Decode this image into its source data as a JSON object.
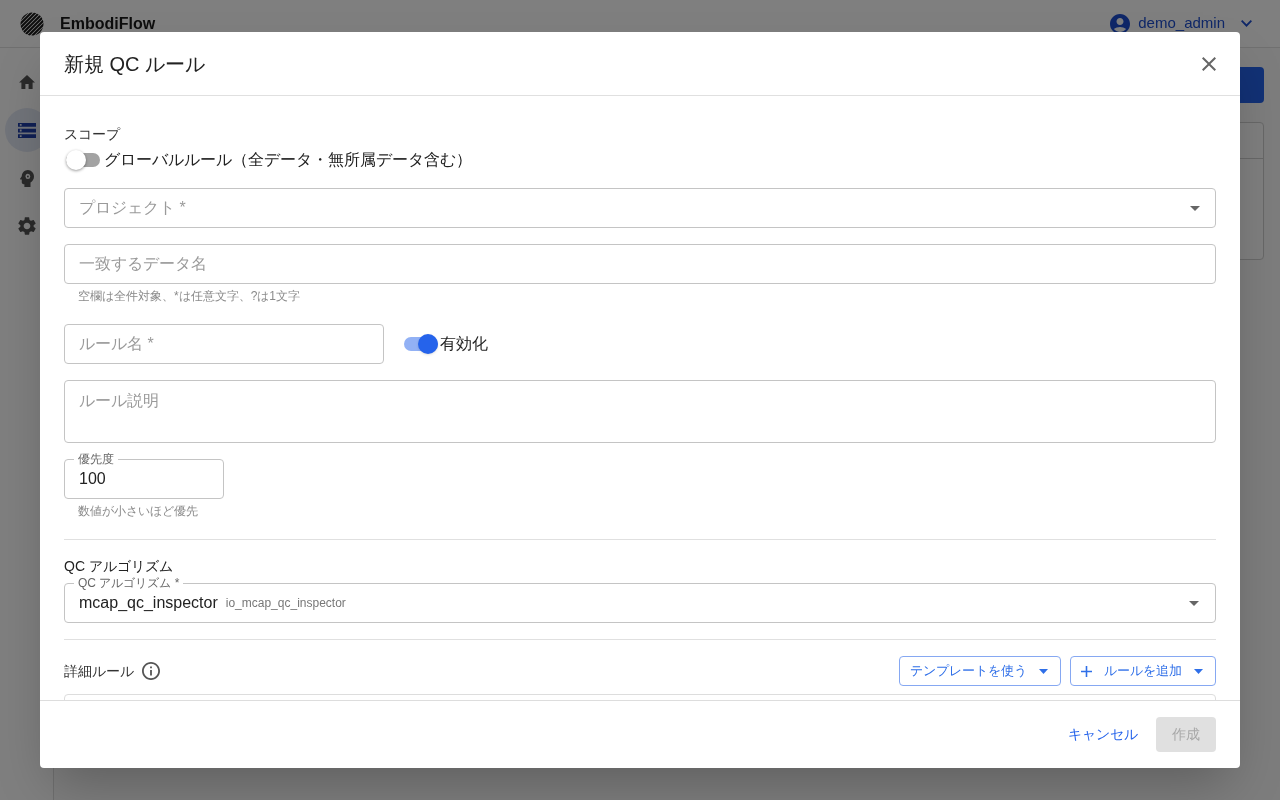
{
  "app_header": {
    "title": "EmbodiFlow",
    "user": "demo_admin"
  },
  "sidebar": {
    "items": [
      {
        "kind": "home",
        "selected": false
      },
      {
        "kind": "list",
        "selected": true
      },
      {
        "kind": "brain",
        "selected": false
      },
      {
        "kind": "settings",
        "selected": false
      }
    ]
  },
  "dialog": {
    "title": "新規 QC ルール",
    "scope": {
      "heading": "スコープ",
      "global_toggle": {
        "label": "グローバルルール（全データ・無所属データ含む）",
        "on": false
      }
    },
    "project_field": {
      "placeholder": "プロジェクト *"
    },
    "data_name_field": {
      "placeholder": "一致するデータ名",
      "helper": "空欄は全件対象、*は任意文字、?は1文字"
    },
    "rule_name_field": {
      "placeholder": "ルール名 *"
    },
    "enabled_toggle": {
      "label": "有効化",
      "on": true
    },
    "description_field": {
      "placeholder": "ルール説明"
    },
    "priority_field": {
      "label": "優先度",
      "value": "100",
      "helper": "数値が小さいほど優先"
    },
    "algorithm": {
      "heading": "QC アルゴリズム",
      "field": {
        "label": "QC アルゴリズム *",
        "value": "mcap_qc_inspector",
        "secondary": "io_mcap_qc_inspector"
      }
    },
    "detail_rules": {
      "heading": "詳細ルール",
      "buttons": [
        {
          "label": "テンプレートを使う",
          "plus": false
        },
        {
          "label": "ルールを追加",
          "plus": true
        }
      ]
    },
    "footer": {
      "buttons": [
        {
          "label": "キャンセル",
          "kind": "text",
          "disabled": false
        },
        {
          "label": "作成",
          "kind": "contained",
          "disabled": true
        }
      ]
    }
  }
}
